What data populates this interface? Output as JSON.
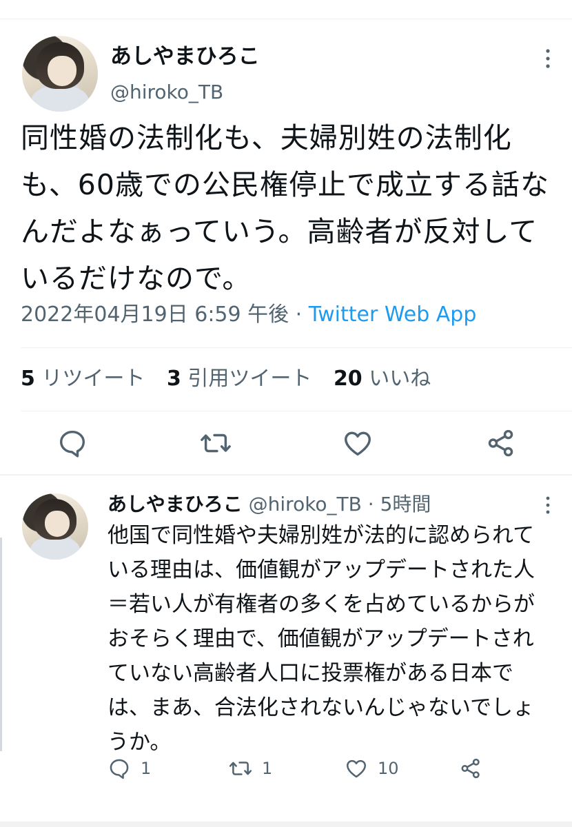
{
  "main_tweet": {
    "display_name": "あしやまひろこ",
    "handle": "@hiroko_TB",
    "text": "同性婚の法制化も、夫婦別姓の法制化も、60歳での公民権停止で成立する話なんだよなぁっていう。高齢者が反対しているだけなので。",
    "timestamp": "2022年04月19日 6:59 午後",
    "separator": " · ",
    "source": "Twitter Web App",
    "stats": {
      "retweets_count": "5",
      "retweets_label": "リツイート",
      "quotes_count": "3",
      "quotes_label": "引用ツイート",
      "likes_count": "20",
      "likes_label": "いいね"
    },
    "icons": [
      "more-icon",
      "reply-icon",
      "retweet-icon",
      "like-icon",
      "share-icon"
    ]
  },
  "reply_tweet": {
    "display_name": "あしやまひろこ",
    "handle": "@hiroko_TB",
    "separator": " · ",
    "time": "5時間",
    "text": "他国で同性婚や夫婦別姓が法的に認められている理由は、価値観がアップデートされた人＝若い人が有権者の多くを占めているからがおそらく理由で、価値観がアップデートされていない高齢者人口に投票権がある日本では、まあ、合法化されないんじゃないでしょうか。",
    "reply_count": "1",
    "retweet_count": "1",
    "like_count": "10"
  },
  "colors": {
    "text": "#0f1419",
    "secondary": "#536471",
    "link": "#1d9bf0",
    "divider": "#eff3f4"
  }
}
